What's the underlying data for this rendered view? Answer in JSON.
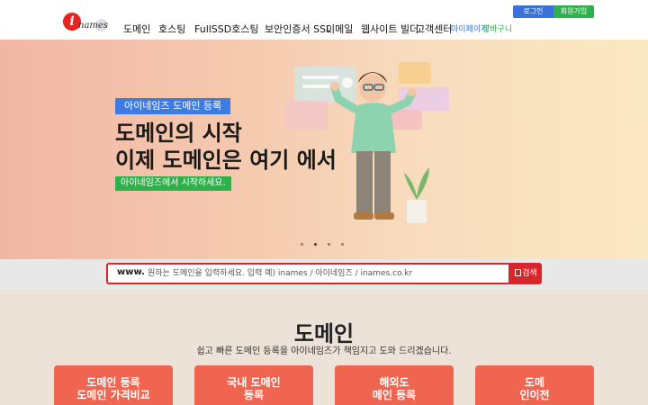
{
  "header": {
    "logo": {
      "mark": "i",
      "word": "names"
    },
    "nav": [
      {
        "label": "도메인"
      },
      {
        "label": "호스팅"
      },
      {
        "label": "FullSSD호스팅"
      },
      {
        "label": "보안인증서 SSL"
      },
      {
        "label": "이메일"
      },
      {
        "label": "웹사이트 빌더"
      },
      {
        "label": "고객센터"
      }
    ],
    "login_label": "로그인",
    "join_label": "회원가입",
    "util_a": "마이페이지",
    "util_b": "장바구니"
  },
  "hero": {
    "badge_top": "아이네임즈 도메인 등록",
    "title_line1": "도메인의 시작",
    "title_line2": "이제 도메인은 여기 에서",
    "badge_bottom": "아이네임즈에서 시작하세요."
  },
  "search": {
    "prefix": "www.",
    "placeholder": "원하는 도메인을 입력하세요. 입력 예) inames / 아이네임즈 / inames.co.kr",
    "button_label": "검색"
  },
  "section": {
    "title": "도메인",
    "subtitle": "쉽고 빠른 도메인 등록을 아이네임즈가 책임지고 도와 드리겠습니다.",
    "cards": [
      {
        "line1": "도메인 등록",
        "line2": "도메인 가격비교"
      },
      {
        "line1": "국내 도메인",
        "line2": "등록"
      },
      {
        "line1": "해외도",
        "line2": "메인 등록"
      },
      {
        "line1": "도메",
        "line2": "인이전"
      }
    ]
  },
  "colors": {
    "brand_red": "#d8262a",
    "login_blue": "#3a73d8",
    "join_green": "#2eb04a",
    "card": "#f0654f"
  },
  "hero_slider": {
    "slides": 4,
    "active": 2
  }
}
